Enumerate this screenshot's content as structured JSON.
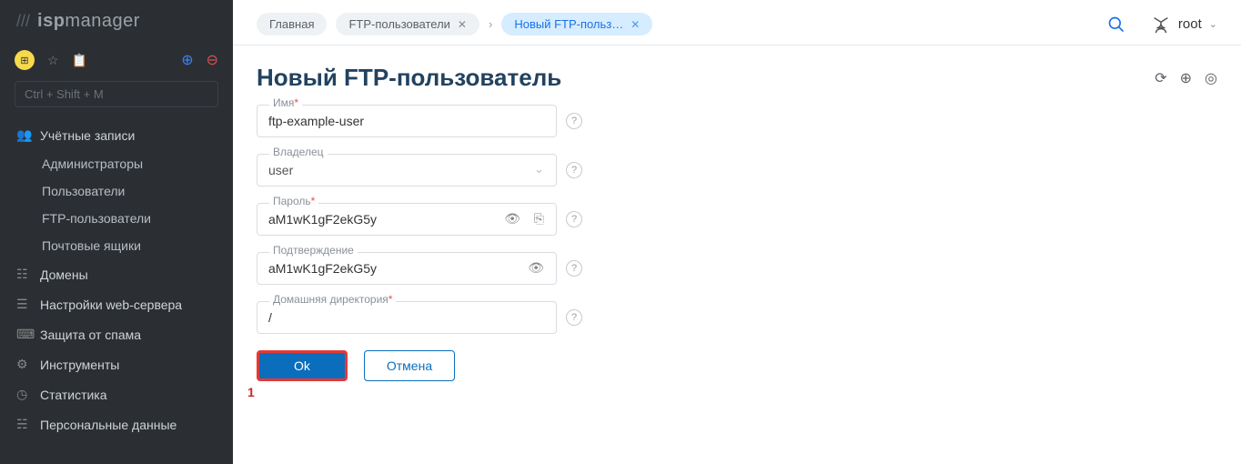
{
  "logo": {
    "prefix": "isp",
    "suffix": "manager"
  },
  "search": {
    "placeholder": "Ctrl + Shift + M"
  },
  "sidebar": {
    "accounts": {
      "label": "Учётные записи",
      "items": [
        "Администраторы",
        "Пользователи",
        "FTP-пользователи",
        "Почтовые ящики"
      ]
    },
    "sections": [
      "Домены",
      "Настройки web-сервера",
      "Защита от спама",
      "Инструменты",
      "Статистика",
      "Персональные данные"
    ]
  },
  "breadcrumbs": {
    "home": "Главная",
    "ftp_users": "FTP-пользователи",
    "new_ftp": "Новый FTP-польз…"
  },
  "user": {
    "name": "root"
  },
  "page": {
    "title": "Новый FTP-пользователь"
  },
  "form": {
    "name": {
      "label": "Имя",
      "value": "ftp-example-user"
    },
    "owner": {
      "label": "Владелец",
      "value": "user"
    },
    "password": {
      "label": "Пароль",
      "value": "aM1wK1gF2ekG5y"
    },
    "confirm": {
      "label": "Подтверждение",
      "value": "aM1wK1gF2ekG5y"
    },
    "homedir": {
      "label": "Домашняя директория",
      "value": "/"
    }
  },
  "buttons": {
    "ok": "Ok",
    "cancel": "Отмена"
  },
  "annotation": {
    "num": "1"
  }
}
